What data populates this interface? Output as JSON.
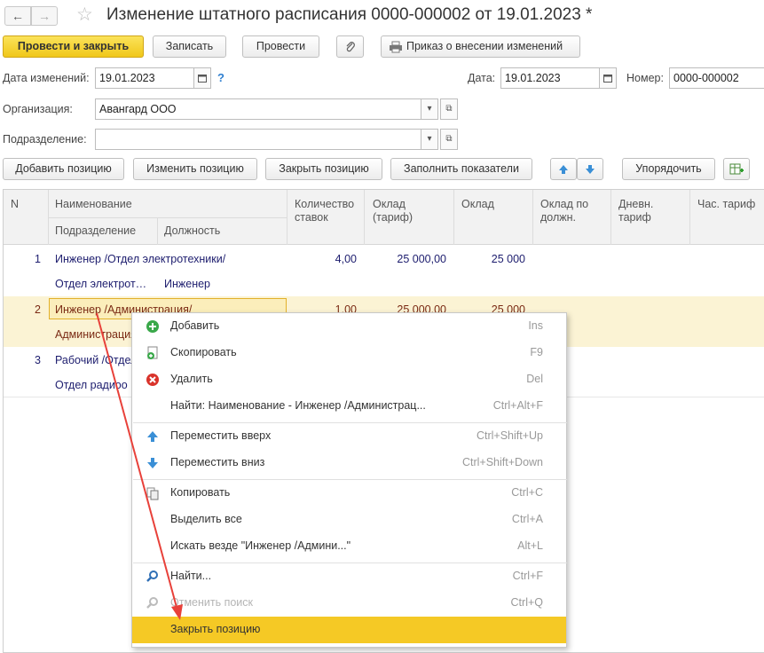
{
  "titlebar": {
    "back": "←",
    "forward": "→",
    "star": "☆",
    "title": "Изменение штатного расписания 0000-000002 от 19.01.2023 *"
  },
  "toolbar": {
    "post_close": "Провести и закрыть",
    "save": "Записать",
    "post": "Провести",
    "order": "Приказ о внесении изменений"
  },
  "form": {
    "change_date_label": "Дата изменений:",
    "change_date_value": "19.01.2023",
    "help": "?",
    "date_label": "Дата:",
    "date_value": "19.01.2023",
    "number_label": "Номер:",
    "number_value": "0000-000002",
    "org_label": "Организация:",
    "org_value": "Авангард ООО",
    "dept_label": "Подразделение:",
    "dept_value": ""
  },
  "table_toolbar": {
    "add": "Добавить позицию",
    "edit": "Изменить позицию",
    "close": "Закрыть позицию",
    "fill": "Заполнить показатели",
    "sort": "Упорядочить"
  },
  "table": {
    "headers": {
      "n": "N",
      "name": "Наименование",
      "dept": "Подразделение",
      "position": "Должность",
      "qty1": "Количество",
      "qty2": "ставок",
      "tariff1": "Оклад",
      "tariff2": "(тариф)",
      "salary": "Оклад",
      "bypos1": "Оклад по",
      "bypos2": "должн.",
      "daily1": "Дневн.",
      "daily2": "тариф",
      "hourly": "Час. тариф"
    },
    "rows": [
      {
        "n": "1",
        "name": "Инженер /Отдел электротехники/",
        "dept": "Отдел электрот…",
        "position": "Инженер",
        "qty": "4,00",
        "tariff": "25 000,00",
        "salary": "25 000"
      },
      {
        "n": "2",
        "name": "Инженер /Администрация/",
        "dept": "Администрация",
        "position": "",
        "qty": "1,00",
        "tariff": "25 000,00",
        "salary": "25 000"
      },
      {
        "n": "3",
        "name": "Рабочий /Отдел",
        "dept": "Отдел радиоо",
        "position": "",
        "qty": "",
        "tariff": "",
        "salary": ""
      }
    ]
  },
  "context_menu": {
    "items": [
      {
        "label": "Добавить",
        "key": "Ins",
        "icon": "add-icon"
      },
      {
        "label": "Скопировать",
        "key": "F9",
        "icon": "copy-row-icon"
      },
      {
        "label": "Удалить",
        "key": "Del",
        "icon": "delete-icon"
      },
      {
        "label": "Найти: Наименование - Инженер /Администрац...",
        "key": "Ctrl+Alt+F",
        "icon": ""
      },
      {
        "label": "Переместить вверх",
        "key": "Ctrl+Shift+Up",
        "icon": "arrow-up-icon"
      },
      {
        "label": "Переместить вниз",
        "key": "Ctrl+Shift+Down",
        "icon": "arrow-down-icon"
      },
      {
        "label": "Копировать",
        "key": "Ctrl+C",
        "icon": "clipboard-copy-icon"
      },
      {
        "label": "Выделить все",
        "key": "Ctrl+A",
        "icon": ""
      },
      {
        "label": "Искать везде \"Инженер /Админи...\"",
        "key": "Alt+L",
        "icon": ""
      },
      {
        "label": "Найти...",
        "key": "Ctrl+F",
        "icon": "find-icon"
      },
      {
        "label": "Отменить поиск",
        "key": "Ctrl+Q",
        "icon": "cancel-search-icon"
      },
      {
        "label": "Закрыть позицию",
        "key": "",
        "icon": ""
      }
    ]
  },
  "colors": {
    "primary_button": "#f0c71a",
    "selected_row": "#fbf3d4",
    "menu_highlight": "#f5c925",
    "annotation_arrow": "#e8413a"
  }
}
